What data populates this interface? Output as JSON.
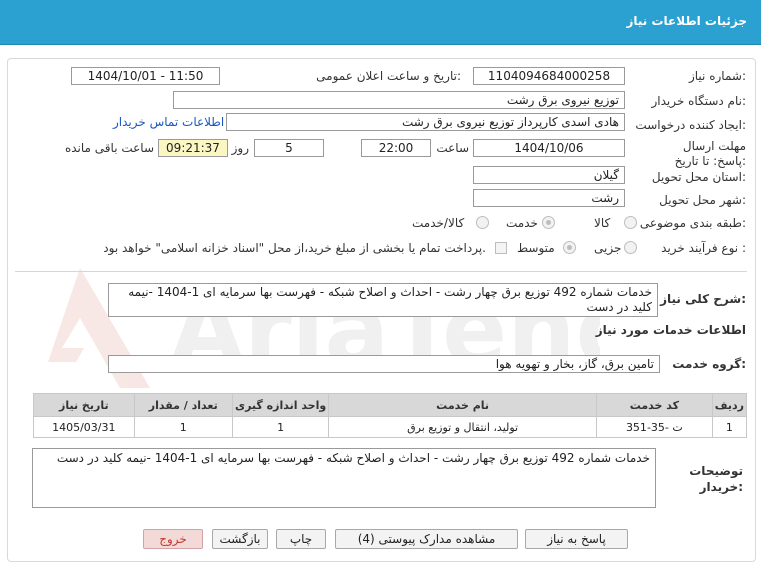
{
  "header": {
    "title": "جزئیات اطلاعات نیاز"
  },
  "form": {
    "need_number_label": "شماره نیاز:",
    "need_number": "1104094684000258",
    "announce_label": "تاریخ و ساعت اعلان عمومی:",
    "announce_value": "1404/10/01 - 11:50",
    "buyer_org_label": "نام دستگاه خریدار:",
    "buyer_org": "توزیع نیروی برق رشت",
    "requester_label": "ایجاد کننده درخواست:",
    "requester": "هادی  اسدی کارپرداز توزیع نیروی برق رشت",
    "contact_link": "اطلاعات تماس خریدار",
    "deadline_label": "مهلت ارسال پاسخ: تا تاریخ:",
    "deadline_date": "1404/10/06",
    "time_label": "ساعت",
    "deadline_time": "22:00",
    "days_value": "5",
    "days_label": "روز و",
    "remaining_time": "09:21:37",
    "remaining_label": "ساعت باقی مانده",
    "province_label": "استان محل تحویل:",
    "province": "گیلان",
    "city_label": "شهر محل تحویل:",
    "city": "رشت",
    "category_label": "طبقه بندی موضوعی:",
    "category_options": [
      "کالا",
      "خدمت",
      "کالا/خدمت"
    ],
    "category_selected": "خدمت",
    "purchase_type_label": "نوع فرآیند خرید :",
    "purchase_options": [
      "جزیی",
      "متوسط"
    ],
    "purchase_selected": "متوسط",
    "payment_note": "پرداخت تمام یا بخشی از مبلغ خرید،از محل \"اسناد خزانه اسلامی\" خواهد بود."
  },
  "summary": {
    "label": "شرح کلی نیاز:",
    "text": "خدمات شماره 492 توزیع برق چهار رشت - احداث و اصلاح شبکه - فهرست بها سرمایه ای 1-1404 -نیمه کلید در دست"
  },
  "services": {
    "section_title": "اطلاعات خدمات مورد نیاز",
    "group_label": "گروه خدمت:",
    "group_value": "تامین برق، گاز، بخار و تهویه هوا",
    "columns": [
      "ردیف",
      "کد خدمت",
      "نام خدمت",
      "واحد اندازه گیری",
      "تعداد / مقدار",
      "تاریخ نیاز"
    ],
    "rows": [
      {
        "row": "1",
        "code": "ت -35-351",
        "name": "تولید، انتقال و توزیع برق",
        "unit": "1",
        "qty": "1",
        "date": "1405/03/31"
      }
    ]
  },
  "buyer_notes": {
    "label": "توضیحات خریدار:",
    "text": "خدمات شماره 492 توزیع برق چهار رشت - احداث و اصلاح شبکه - فهرست بها سرمایه ای 1-1404 -نیمه کلید در دست"
  },
  "buttons": {
    "reply": "پاسخ به نیاز",
    "attachments": "مشاهده مدارک پیوستی (4)",
    "print": "چاپ",
    "back": "بازگشت",
    "exit": "خروج"
  },
  "watermark": {
    "text": "AriaTender.net"
  },
  "colors": {
    "header": "#2aa1d1",
    "remaining_bg": "#fbf6c2",
    "link": "#1a58c0",
    "exit": "#c0392b"
  }
}
